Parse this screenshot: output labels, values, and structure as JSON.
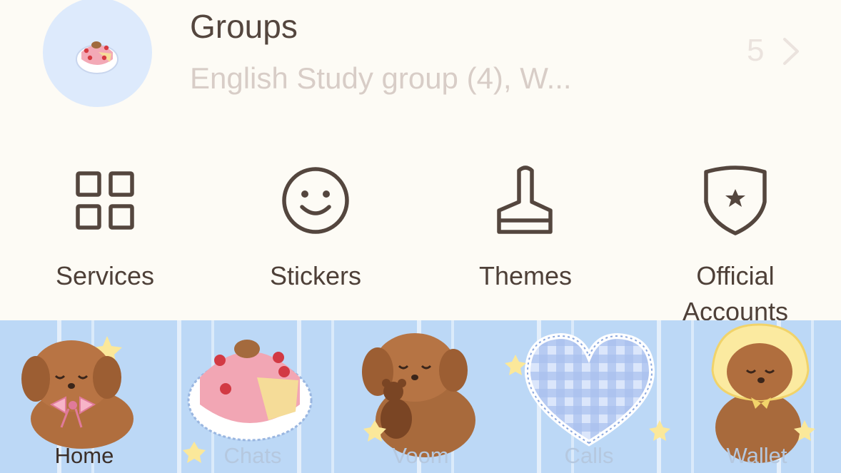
{
  "groups": {
    "title": "Groups",
    "subtitle": "English Study group (4), W...",
    "count": "5",
    "avatar_icon": "cake-icon"
  },
  "shortcuts": [
    {
      "label": "Services",
      "icon": "grid-icon"
    },
    {
      "label": "Stickers",
      "icon": "smiley-icon"
    },
    {
      "label": "Themes",
      "icon": "brush-icon"
    },
    {
      "label": "Official Accounts",
      "icon": "shield-star-icon"
    }
  ],
  "tabs": [
    {
      "label": "Home",
      "icon": "dog-ribbon-icon",
      "active": true
    },
    {
      "label": "Chats",
      "icon": "cake-icon",
      "active": false
    },
    {
      "label": "Voom",
      "icon": "dog-teddy-icon",
      "active": false
    },
    {
      "label": "Calls",
      "icon": "heart-icon",
      "active": false
    },
    {
      "label": "Wallet",
      "icon": "dog-bonnet-icon",
      "active": false
    }
  ],
  "colors": {
    "background": "#fdfbf5",
    "text": "#4e4038",
    "muted": "#d8cdc7",
    "tabbar": "#bcd8f6",
    "avatar_bg": "#ddeafc"
  }
}
